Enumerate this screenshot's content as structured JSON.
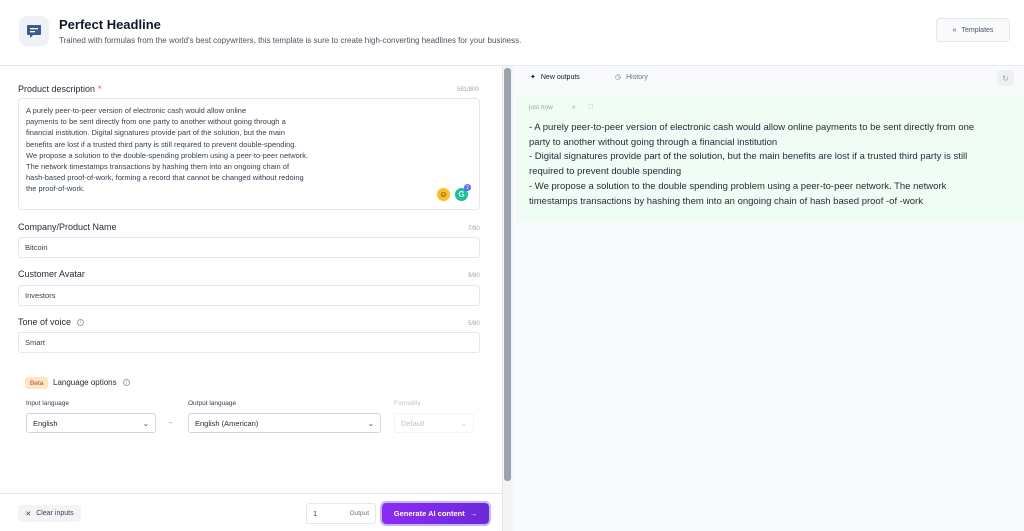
{
  "header": {
    "title": "Perfect Headline",
    "subtitle": "Trained with formulas from the world's best copywriters, this template is sure to create high-converting headlines for your business.",
    "templates_label": "Templates"
  },
  "form": {
    "product_description": {
      "label": "Product description",
      "required_mark": "*",
      "counter": "581/800",
      "lines": [
        "A purely peer-to-peer version of electronic cash would allow online",
        "payments to be sent directly from one party to another without going through a",
        "financial institution. Digital signatures provide part of the solution, but the main",
        "benefits are lost if a trusted third party is still required to prevent double-spending.",
        "We propose a solution to the double-spending problem using a peer-to-peer network.",
        "The network timestamps transactions by hashing them into an ongoing chain of",
        "hash-based proof-of-work, forming a record that cannot be changed without redoing",
        "the proof-of-work."
      ],
      "grammarly_count": "2"
    },
    "company": {
      "label": "Company/Product Name",
      "counter": "7/80",
      "value": "Bitcoin"
    },
    "avatar": {
      "label": "Customer Avatar",
      "counter": "9/80",
      "value": "Investors"
    },
    "tone": {
      "label": "Tone of voice",
      "counter": "5/80",
      "value": "Smart"
    },
    "language": {
      "beta": "Beta",
      "label": "Language options",
      "input_label": "Input language",
      "input_value": "English",
      "output_label": "Output language",
      "output_value": "English (American)",
      "formality_label": "Formality",
      "formality_value": "Default"
    }
  },
  "footer": {
    "clear_label": "Clear inputs",
    "output_count": "1",
    "output_label": "Output",
    "generate_label": "Generate AI content"
  },
  "outputs": {
    "tab_new": "New outputs",
    "tab_history": "History",
    "time": "just now",
    "lines": [
      "- A purely peer-to-peer version of electronic cash would allow online payments to be sent directly from one",
      "party to another without going through a financial institution",
      "- Digital signatures provide part of the solution, but the main benefits are lost if a trusted third party is still",
      "required to prevent double spending",
      "- We propose a solution to the double spending problem using a peer-to-peer network. The network",
      "timestamps transactions by hashing them into an ongoing chain of hash based proof -of -work"
    ]
  },
  "colors": {
    "accent": "#7c3aed",
    "output_bg": "#f0fdf4",
    "beta_bg": "#fde7c7",
    "beta_text": "#c2410c"
  }
}
